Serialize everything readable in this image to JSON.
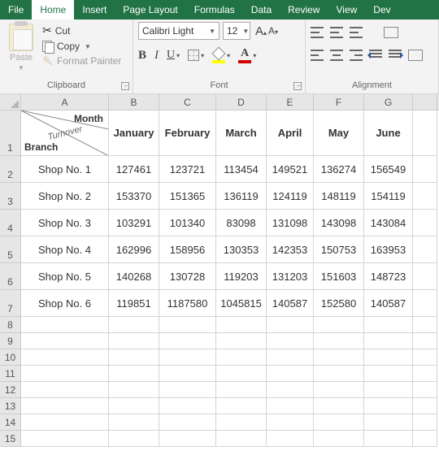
{
  "tabs": [
    "File",
    "Home",
    "Insert",
    "Page Layout",
    "Formulas",
    "Data",
    "Review",
    "View",
    "Dev"
  ],
  "active_tab": "Home",
  "ribbon": {
    "clipboard": {
      "paste": "Paste",
      "cut": "Cut",
      "copy": "Copy",
      "format_painter": "Format Painter",
      "group_label": "Clipboard"
    },
    "font": {
      "font_name": "Calibri Light",
      "font_size": "12",
      "bold": "B",
      "italic": "I",
      "underline": "U",
      "font_color_letter": "A",
      "group_label": "Font"
    },
    "alignment": {
      "group_label": "Alignment"
    }
  },
  "columns": [
    "A",
    "B",
    "C",
    "D",
    "E",
    "F",
    "G"
  ],
  "header_cell": {
    "month": "Month",
    "turnover": "Turnover",
    "branch": "Branch"
  },
  "months": [
    "January",
    "February",
    "March",
    "April",
    "May",
    "June"
  ],
  "rows": [
    {
      "label": "Shop No. 1",
      "values": [
        "127461",
        "123721",
        "113454",
        "149521",
        "136274",
        "156549"
      ]
    },
    {
      "label": "Shop No. 2",
      "values": [
        "153370",
        "151365",
        "136119",
        "124119",
        "148119",
        "154119"
      ]
    },
    {
      "label": "Shop No. 3",
      "values": [
        "103291",
        "101340",
        "83098",
        "131098",
        "143098",
        "143084"
      ]
    },
    {
      "label": "Shop No. 4",
      "values": [
        "162996",
        "158956",
        "130353",
        "142353",
        "150753",
        "163953"
      ]
    },
    {
      "label": "Shop No. 5",
      "values": [
        "140268",
        "130728",
        "119203",
        "131203",
        "151603",
        "148723"
      ]
    },
    {
      "label": "Shop No. 6",
      "values": [
        "119851",
        "1187580",
        "1045815",
        "140587",
        "152580",
        "140587"
      ]
    }
  ],
  "row_numbers": [
    "1",
    "2",
    "3",
    "4",
    "5",
    "6",
    "7",
    "8",
    "9",
    "10",
    "11",
    "12",
    "13",
    "14",
    "15"
  ]
}
